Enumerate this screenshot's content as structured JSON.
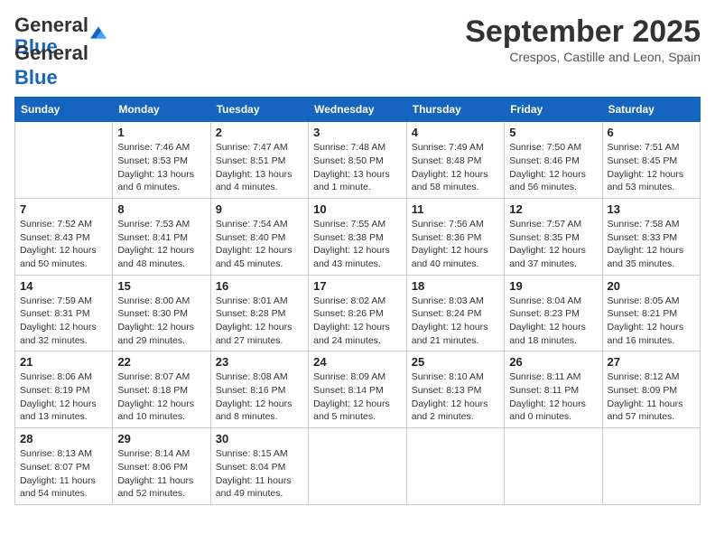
{
  "header": {
    "logo_general": "General",
    "logo_blue": "Blue",
    "month_title": "September 2025",
    "subtitle": "Crespos, Castille and Leon, Spain"
  },
  "calendar": {
    "days_of_week": [
      "Sunday",
      "Monday",
      "Tuesday",
      "Wednesday",
      "Thursday",
      "Friday",
      "Saturday"
    ],
    "weeks": [
      [
        {
          "day": "",
          "sunrise": "",
          "sunset": "",
          "daylight": ""
        },
        {
          "day": "1",
          "sunrise": "Sunrise: 7:46 AM",
          "sunset": "Sunset: 8:53 PM",
          "daylight": "Daylight: 13 hours and 6 minutes."
        },
        {
          "day": "2",
          "sunrise": "Sunrise: 7:47 AM",
          "sunset": "Sunset: 8:51 PM",
          "daylight": "Daylight: 13 hours and 4 minutes."
        },
        {
          "day": "3",
          "sunrise": "Sunrise: 7:48 AM",
          "sunset": "Sunset: 8:50 PM",
          "daylight": "Daylight: 13 hours and 1 minute."
        },
        {
          "day": "4",
          "sunrise": "Sunrise: 7:49 AM",
          "sunset": "Sunset: 8:48 PM",
          "daylight": "Daylight: 12 hours and 58 minutes."
        },
        {
          "day": "5",
          "sunrise": "Sunrise: 7:50 AM",
          "sunset": "Sunset: 8:46 PM",
          "daylight": "Daylight: 12 hours and 56 minutes."
        },
        {
          "day": "6",
          "sunrise": "Sunrise: 7:51 AM",
          "sunset": "Sunset: 8:45 PM",
          "daylight": "Daylight: 12 hours and 53 minutes."
        }
      ],
      [
        {
          "day": "7",
          "sunrise": "Sunrise: 7:52 AM",
          "sunset": "Sunset: 8:43 PM",
          "daylight": "Daylight: 12 hours and 50 minutes."
        },
        {
          "day": "8",
          "sunrise": "Sunrise: 7:53 AM",
          "sunset": "Sunset: 8:41 PM",
          "daylight": "Daylight: 12 hours and 48 minutes."
        },
        {
          "day": "9",
          "sunrise": "Sunrise: 7:54 AM",
          "sunset": "Sunset: 8:40 PM",
          "daylight": "Daylight: 12 hours and 45 minutes."
        },
        {
          "day": "10",
          "sunrise": "Sunrise: 7:55 AM",
          "sunset": "Sunset: 8:38 PM",
          "daylight": "Daylight: 12 hours and 43 minutes."
        },
        {
          "day": "11",
          "sunrise": "Sunrise: 7:56 AM",
          "sunset": "Sunset: 8:36 PM",
          "daylight": "Daylight: 12 hours and 40 minutes."
        },
        {
          "day": "12",
          "sunrise": "Sunrise: 7:57 AM",
          "sunset": "Sunset: 8:35 PM",
          "daylight": "Daylight: 12 hours and 37 minutes."
        },
        {
          "day": "13",
          "sunrise": "Sunrise: 7:58 AM",
          "sunset": "Sunset: 8:33 PM",
          "daylight": "Daylight: 12 hours and 35 minutes."
        }
      ],
      [
        {
          "day": "14",
          "sunrise": "Sunrise: 7:59 AM",
          "sunset": "Sunset: 8:31 PM",
          "daylight": "Daylight: 12 hours and 32 minutes."
        },
        {
          "day": "15",
          "sunrise": "Sunrise: 8:00 AM",
          "sunset": "Sunset: 8:30 PM",
          "daylight": "Daylight: 12 hours and 29 minutes."
        },
        {
          "day": "16",
          "sunrise": "Sunrise: 8:01 AM",
          "sunset": "Sunset: 8:28 PM",
          "daylight": "Daylight: 12 hours and 27 minutes."
        },
        {
          "day": "17",
          "sunrise": "Sunrise: 8:02 AM",
          "sunset": "Sunset: 8:26 PM",
          "daylight": "Daylight: 12 hours and 24 minutes."
        },
        {
          "day": "18",
          "sunrise": "Sunrise: 8:03 AM",
          "sunset": "Sunset: 8:24 PM",
          "daylight": "Daylight: 12 hours and 21 minutes."
        },
        {
          "day": "19",
          "sunrise": "Sunrise: 8:04 AM",
          "sunset": "Sunset: 8:23 PM",
          "daylight": "Daylight: 12 hours and 18 minutes."
        },
        {
          "day": "20",
          "sunrise": "Sunrise: 8:05 AM",
          "sunset": "Sunset: 8:21 PM",
          "daylight": "Daylight: 12 hours and 16 minutes."
        }
      ],
      [
        {
          "day": "21",
          "sunrise": "Sunrise: 8:06 AM",
          "sunset": "Sunset: 8:19 PM",
          "daylight": "Daylight: 12 hours and 13 minutes."
        },
        {
          "day": "22",
          "sunrise": "Sunrise: 8:07 AM",
          "sunset": "Sunset: 8:18 PM",
          "daylight": "Daylight: 12 hours and 10 minutes."
        },
        {
          "day": "23",
          "sunrise": "Sunrise: 8:08 AM",
          "sunset": "Sunset: 8:16 PM",
          "daylight": "Daylight: 12 hours and 8 minutes."
        },
        {
          "day": "24",
          "sunrise": "Sunrise: 8:09 AM",
          "sunset": "Sunset: 8:14 PM",
          "daylight": "Daylight: 12 hours and 5 minutes."
        },
        {
          "day": "25",
          "sunrise": "Sunrise: 8:10 AM",
          "sunset": "Sunset: 8:13 PM",
          "daylight": "Daylight: 12 hours and 2 minutes."
        },
        {
          "day": "26",
          "sunrise": "Sunrise: 8:11 AM",
          "sunset": "Sunset: 8:11 PM",
          "daylight": "Daylight: 12 hours and 0 minutes."
        },
        {
          "day": "27",
          "sunrise": "Sunrise: 8:12 AM",
          "sunset": "Sunset: 8:09 PM",
          "daylight": "Daylight: 11 hours and 57 minutes."
        }
      ],
      [
        {
          "day": "28",
          "sunrise": "Sunrise: 8:13 AM",
          "sunset": "Sunset: 8:07 PM",
          "daylight": "Daylight: 11 hours and 54 minutes."
        },
        {
          "day": "29",
          "sunrise": "Sunrise: 8:14 AM",
          "sunset": "Sunset: 8:06 PM",
          "daylight": "Daylight: 11 hours and 52 minutes."
        },
        {
          "day": "30",
          "sunrise": "Sunrise: 8:15 AM",
          "sunset": "Sunset: 8:04 PM",
          "daylight": "Daylight: 11 hours and 49 minutes."
        },
        {
          "day": "",
          "sunrise": "",
          "sunset": "",
          "daylight": ""
        },
        {
          "day": "",
          "sunrise": "",
          "sunset": "",
          "daylight": ""
        },
        {
          "day": "",
          "sunrise": "",
          "sunset": "",
          "daylight": ""
        },
        {
          "day": "",
          "sunrise": "",
          "sunset": "",
          "daylight": ""
        }
      ]
    ]
  }
}
